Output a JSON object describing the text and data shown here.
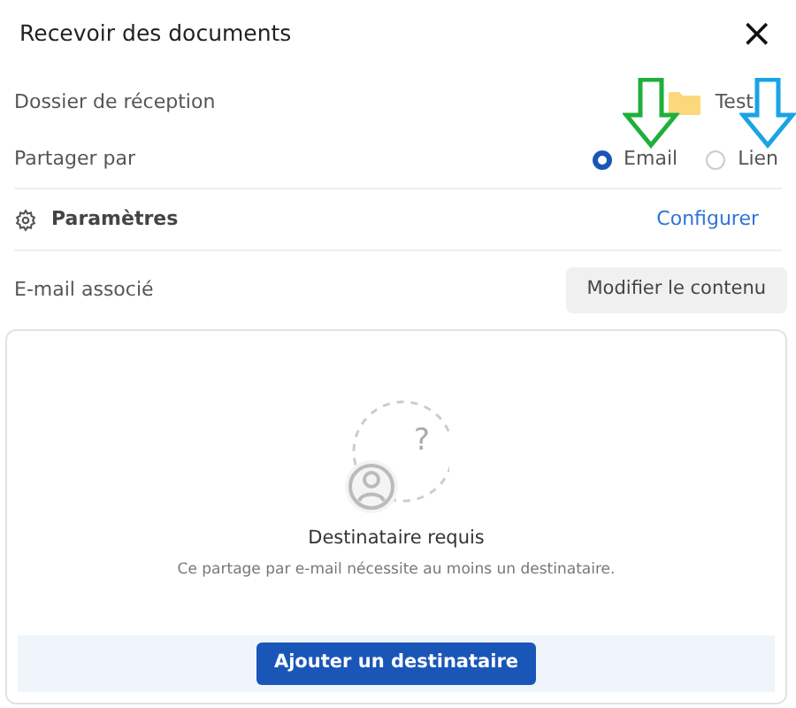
{
  "dialog": {
    "title": "Recevoir des documents",
    "close": "×"
  },
  "folder": {
    "label": "Dossier de réception",
    "value": "Test"
  },
  "share": {
    "label": "Partager par",
    "options": [
      {
        "label": "Email",
        "selected": true
      },
      {
        "label": "Lien",
        "selected": false
      }
    ]
  },
  "settings": {
    "label": "Paramètres",
    "action": "Configurer"
  },
  "email": {
    "label": "E-mail associé",
    "button": "Modifier le contenu"
  },
  "empty_state": {
    "mark": "?",
    "title": "Destinataire requis",
    "text": "Ce partage par e-mail nécessite au moins un destinataire.",
    "button": "Ajouter un destinataire"
  },
  "annotations": [
    {
      "kind": "arrow",
      "color": "#1fb03c"
    },
    {
      "kind": "arrow",
      "color": "#1aa3e6"
    }
  ]
}
